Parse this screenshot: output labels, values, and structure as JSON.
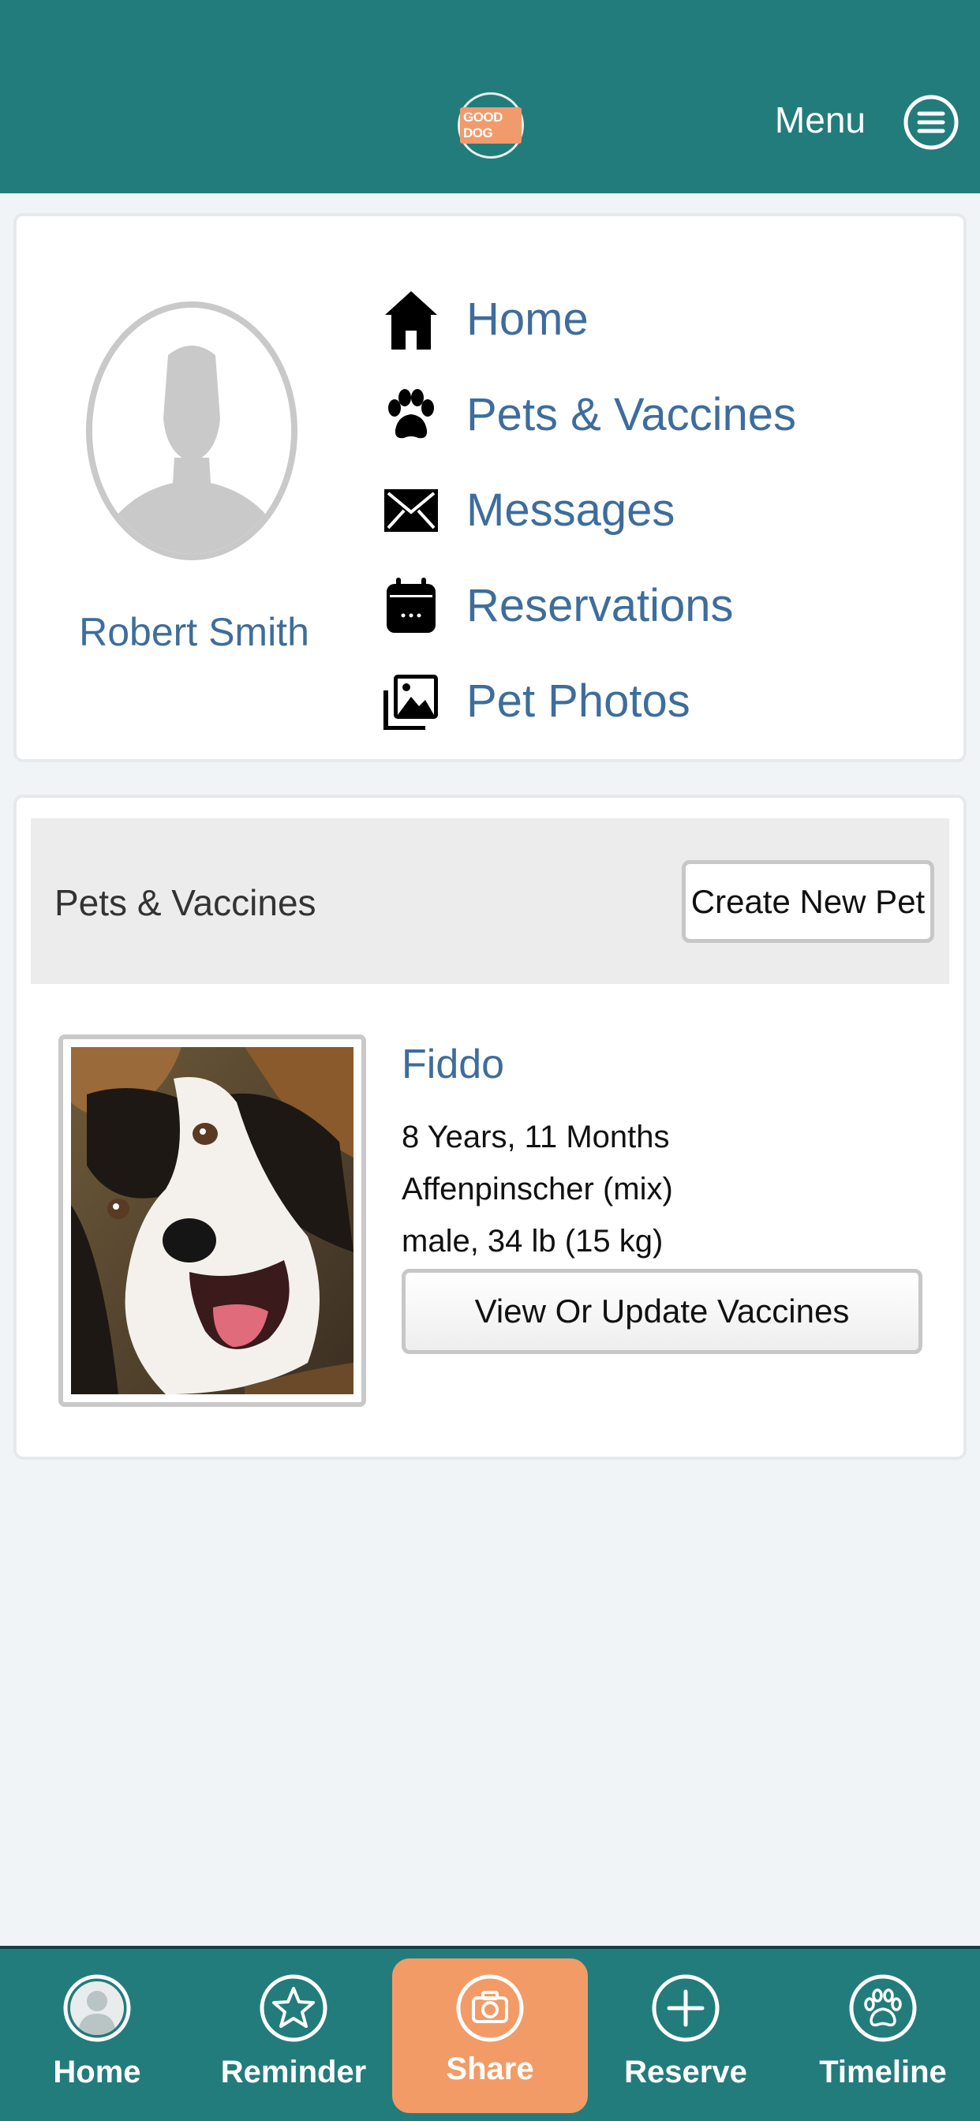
{
  "header": {
    "logo_text": "GOOD DOG",
    "menu_label": "Menu",
    "menu_icon": "hamburger-icon"
  },
  "profile": {
    "name": "Robert Smith",
    "avatar_icon": "person-silhouette-icon"
  },
  "nav": {
    "items": [
      {
        "label": "Home",
        "icon": "home-icon"
      },
      {
        "label": "Pets & Vaccines",
        "icon": "paw-icon"
      },
      {
        "label": "Messages",
        "icon": "envelope-icon"
      },
      {
        "label": "Reservations",
        "icon": "calendar-icon"
      },
      {
        "label": "Pet Photos",
        "icon": "photos-icon"
      }
    ]
  },
  "pets": {
    "title": "Pets & Vaccines",
    "create_label": "Create New Pet",
    "list": [
      {
        "name": "Fiddo",
        "age": "8 Years, 11 Months",
        "breed": "Affenpinscher (mix)",
        "details": "male, 34 lb (15 kg)",
        "action_label": "View Or Update Vaccines"
      }
    ]
  },
  "tabbar": {
    "items": [
      {
        "label": "Home",
        "icon": "person-circle-icon"
      },
      {
        "label": "Reminder",
        "icon": "star-icon"
      },
      {
        "label": "Share",
        "icon": "camera-icon",
        "active": true
      },
      {
        "label": "Reserve",
        "icon": "plus-circle-icon"
      },
      {
        "label": "Timeline",
        "icon": "paw-circle-icon"
      }
    ]
  },
  "colors": {
    "teal": "#237c7c",
    "accent_orange": "#f29b67",
    "link_blue": "#3d6d9c",
    "background": "#f0f4f7"
  }
}
